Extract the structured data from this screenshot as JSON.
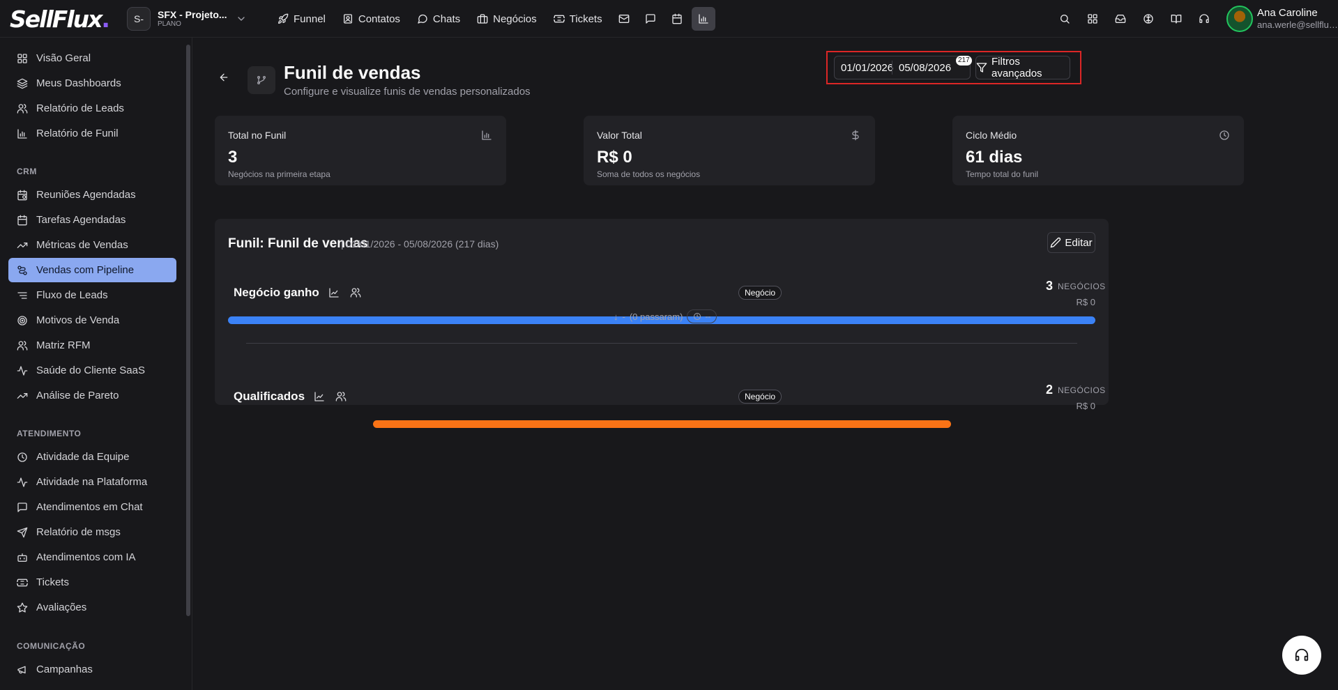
{
  "brand": {
    "logo": "SellFlux",
    "logo_dot": "."
  },
  "workspace": {
    "initials": "S-",
    "name": "SFX - Projeto...",
    "plan": "PLANO"
  },
  "topnav": {
    "items": [
      {
        "label": "Funnel",
        "icon": "rocket-icon"
      },
      {
        "label": "Contatos",
        "icon": "contact-icon"
      },
      {
        "label": "Chats",
        "icon": "chat-icon"
      },
      {
        "label": "Negócios",
        "icon": "briefcase-icon"
      },
      {
        "label": "Tickets",
        "icon": "ticket-icon"
      }
    ],
    "icon_buttons": [
      "mail-icon",
      "message-square-icon",
      "calendar-icon",
      "bar-chart-icon"
    ]
  },
  "user": {
    "name": "Ana Caroline",
    "email": "ana.werle@sellflux..."
  },
  "sidebar": {
    "items": [
      {
        "label": "Visão Geral",
        "icon": "grid-icon"
      },
      {
        "label": "Meus Dashboards",
        "icon": "layers-icon"
      },
      {
        "label": "Relatório de Leads",
        "icon": "users-icon"
      },
      {
        "label": "Relatório de Funil",
        "icon": "bar-chart-icon"
      }
    ],
    "crm_title": "CRM",
    "crm_items": [
      {
        "label": "Reuniões Agendadas",
        "icon": "calendar-clock-icon"
      },
      {
        "label": "Tarefas Agendadas",
        "icon": "calendar-icon"
      },
      {
        "label": "Métricas de Vendas",
        "icon": "trending-up-icon"
      },
      {
        "label": "Vendas com Pipeline",
        "icon": "pipeline-icon"
      },
      {
        "label": "Fluxo de Leads",
        "icon": "list-icon"
      },
      {
        "label": "Motivos de Venda",
        "icon": "target-icon"
      },
      {
        "label": "Matriz RFM",
        "icon": "users-icon"
      },
      {
        "label": "Saúde do Cliente SaaS",
        "icon": "activity-icon"
      },
      {
        "label": "Análise de Pareto",
        "icon": "trending-up-icon"
      }
    ],
    "atendimento_title": "ATENDIMENTO",
    "atendimento_items": [
      {
        "label": "Atividade da Equipe",
        "icon": "clock-icon"
      },
      {
        "label": "Atividade na Plataforma",
        "icon": "activity-icon"
      },
      {
        "label": "Atendimentos em Chat",
        "icon": "chat-icon"
      },
      {
        "label": "Relatório de msgs",
        "icon": "send-icon"
      },
      {
        "label": "Atendimentos com IA",
        "icon": "bot-icon"
      },
      {
        "label": "Tickets",
        "icon": "ticket-icon"
      },
      {
        "label": "Avaliações",
        "icon": "star-icon"
      }
    ],
    "comunicacao_title": "COMUNICAÇÃO",
    "comunicacao_items": [
      {
        "label": "Campanhas",
        "icon": "megaphone-icon"
      }
    ]
  },
  "page": {
    "title": "Funil de vendas",
    "subtitle": "Configure e visualize funis de vendas personalizados"
  },
  "date_filter": {
    "start": "01/01/2026",
    "end": "05/08/2026",
    "days_badge": "217",
    "advanced_filters_label": "Filtros avançados"
  },
  "kpis": [
    {
      "label": "Total no Funil",
      "value": "3",
      "desc": "Negócios na primeira etapa",
      "icon": "bar-chart-icon"
    },
    {
      "label": "Valor Total",
      "value": "R$ 0",
      "desc": "Soma de todos os negócios",
      "icon": "dollar-icon"
    },
    {
      "label": "Ciclo Médio",
      "value": "61 dias",
      "desc": "Tempo total do funil",
      "icon": "clock-icon"
    }
  ],
  "funnel": {
    "title": "Funil: Funil de vendas",
    "range": "| 01/01/2026 - 05/08/2026 (217 dias)",
    "edit_label": "Editar",
    "unit_label": "NEGÓCIOS",
    "stages": [
      {
        "name": "Negócio ganho",
        "badge": "Negócio",
        "count": "3",
        "value": "R$ 0",
        "color": "#3b82f6",
        "share": 1.0
      },
      {
        "name": "Qualificados",
        "badge": "Negócio",
        "count": "2",
        "value": "R$ 0",
        "color": "#f97316",
        "share": 0.6667
      }
    ],
    "transition": {
      "arrow": "↓",
      "dash": "-",
      "passed": "(0 passaram)",
      "time": "--"
    }
  }
}
